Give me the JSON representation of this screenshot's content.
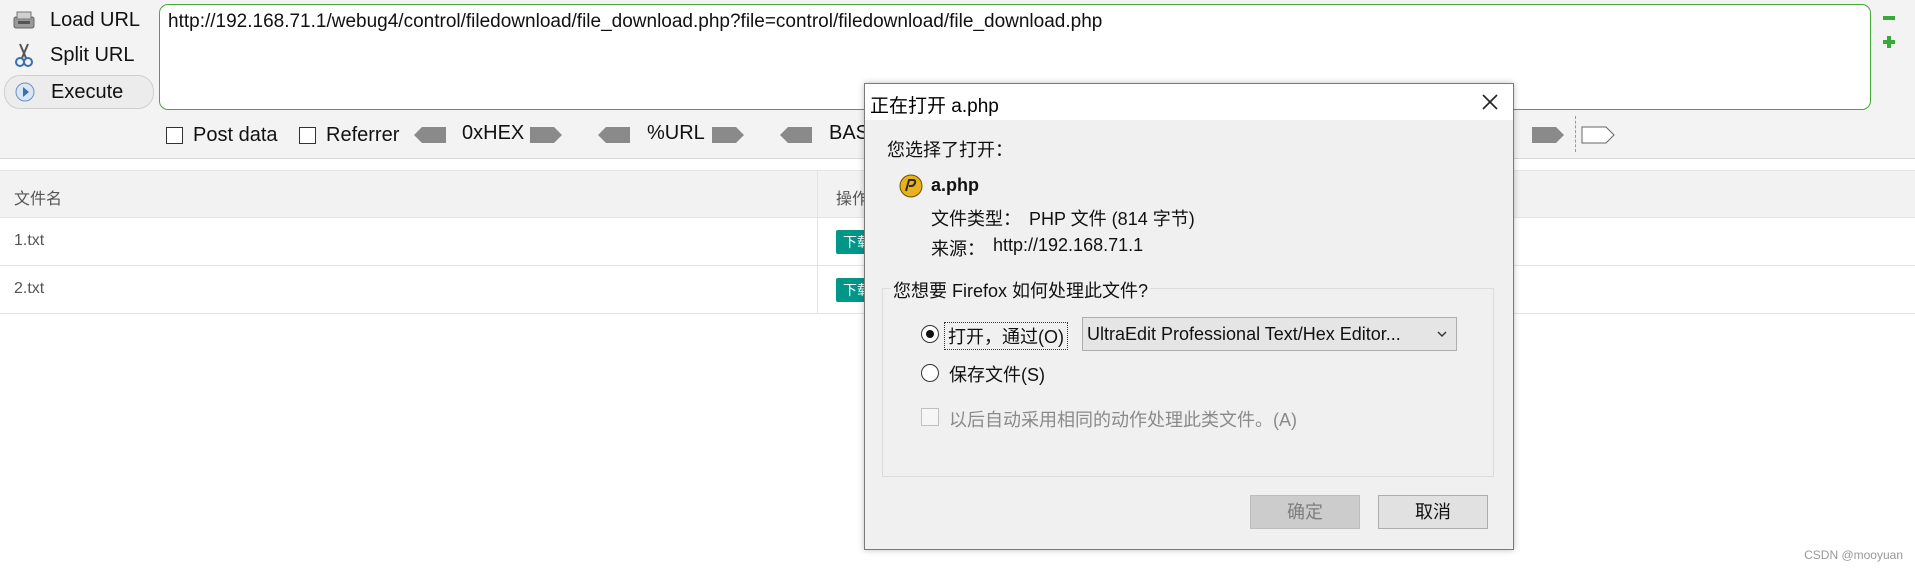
{
  "hackbar": {
    "load_url": "Load URL",
    "split_url": "Split URL",
    "execute": "Execute",
    "url": "http://192.168.71.1/webug4/control/filedownload/file_download.php?file=control/filedownload/file_download.php",
    "post_data": "Post data",
    "referrer": "Referrer",
    "hex": "0xHEX",
    "urlenc": "%URL",
    "base64": "BAS",
    "accent_color": "#49a83c"
  },
  "table": {
    "columns": [
      "文件名",
      "操作"
    ],
    "rows": [
      {
        "name": "1.txt",
        "action": "下载"
      },
      {
        "name": "2.txt",
        "action": "下载"
      }
    ],
    "button_color": "#009688"
  },
  "watermark": "CSDN @mooyuan",
  "dialog": {
    "title": "正在打开 a.php",
    "selected_prompt": "您选择了打开：",
    "file_icon": "php-file-icon",
    "file_name": "a.php",
    "type_label": "文件类型：",
    "type_value": "PHP 文件 (814 字节)",
    "source_label": "来源：",
    "source_value": "http://192.168.71.1",
    "handle_prompt": "您想要 Firefox 如何处理此文件?",
    "open_with_label": "打开，通过(O)",
    "open_with_app": "UltraEdit Professional Text/Hex Editor...",
    "save_label": "保存文件(S)",
    "auto_label": "以后自动采用相同的动作处理此类文件。(A)",
    "ok": "确定",
    "cancel": "取消",
    "selected_option": "open"
  }
}
